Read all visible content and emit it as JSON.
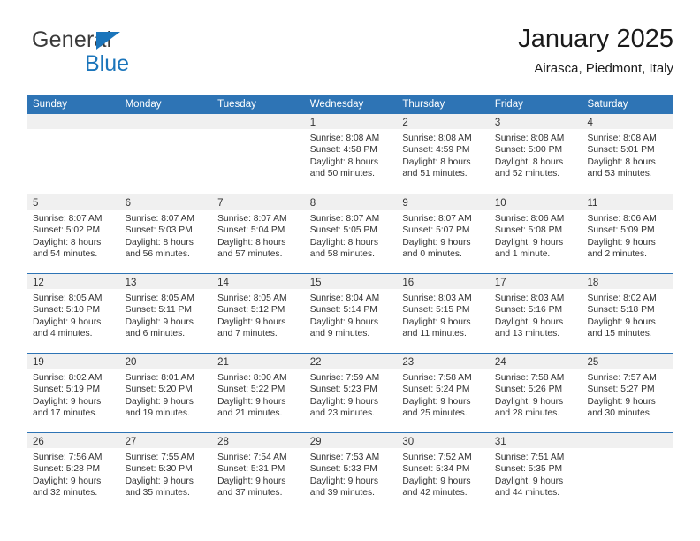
{
  "brand": {
    "name_top": "General",
    "name_bottom": "Blue",
    "triangle_color": "#1b75bb",
    "top_color": "#3b3b3b"
  },
  "header": {
    "title": "January 2025",
    "subtitle": "Airasca, Piedmont, Italy"
  },
  "theme": {
    "header_bg": "#2e74b5",
    "header_text": "#ffffff",
    "daynum_band_bg": "#f0f0f0",
    "cell_text": "#333333"
  },
  "weekdays": [
    "Sunday",
    "Monday",
    "Tuesday",
    "Wednesday",
    "Thursday",
    "Friday",
    "Saturday"
  ],
  "weeks": [
    [
      {
        "day": "",
        "lines": []
      },
      {
        "day": "",
        "lines": []
      },
      {
        "day": "",
        "lines": []
      },
      {
        "day": "1",
        "lines": [
          "Sunrise: 8:08 AM",
          "Sunset: 4:58 PM",
          "Daylight: 8 hours",
          "and 50 minutes."
        ]
      },
      {
        "day": "2",
        "lines": [
          "Sunrise: 8:08 AM",
          "Sunset: 4:59 PM",
          "Daylight: 8 hours",
          "and 51 minutes."
        ]
      },
      {
        "day": "3",
        "lines": [
          "Sunrise: 8:08 AM",
          "Sunset: 5:00 PM",
          "Daylight: 8 hours",
          "and 52 minutes."
        ]
      },
      {
        "day": "4",
        "lines": [
          "Sunrise: 8:08 AM",
          "Sunset: 5:01 PM",
          "Daylight: 8 hours",
          "and 53 minutes."
        ]
      }
    ],
    [
      {
        "day": "5",
        "lines": [
          "Sunrise: 8:07 AM",
          "Sunset: 5:02 PM",
          "Daylight: 8 hours",
          "and 54 minutes."
        ]
      },
      {
        "day": "6",
        "lines": [
          "Sunrise: 8:07 AM",
          "Sunset: 5:03 PM",
          "Daylight: 8 hours",
          "and 56 minutes."
        ]
      },
      {
        "day": "7",
        "lines": [
          "Sunrise: 8:07 AM",
          "Sunset: 5:04 PM",
          "Daylight: 8 hours",
          "and 57 minutes."
        ]
      },
      {
        "day": "8",
        "lines": [
          "Sunrise: 8:07 AM",
          "Sunset: 5:05 PM",
          "Daylight: 8 hours",
          "and 58 minutes."
        ]
      },
      {
        "day": "9",
        "lines": [
          "Sunrise: 8:07 AM",
          "Sunset: 5:07 PM",
          "Daylight: 9 hours",
          "and 0 minutes."
        ]
      },
      {
        "day": "10",
        "lines": [
          "Sunrise: 8:06 AM",
          "Sunset: 5:08 PM",
          "Daylight: 9 hours",
          "and 1 minute."
        ]
      },
      {
        "day": "11",
        "lines": [
          "Sunrise: 8:06 AM",
          "Sunset: 5:09 PM",
          "Daylight: 9 hours",
          "and 2 minutes."
        ]
      }
    ],
    [
      {
        "day": "12",
        "lines": [
          "Sunrise: 8:05 AM",
          "Sunset: 5:10 PM",
          "Daylight: 9 hours",
          "and 4 minutes."
        ]
      },
      {
        "day": "13",
        "lines": [
          "Sunrise: 8:05 AM",
          "Sunset: 5:11 PM",
          "Daylight: 9 hours",
          "and 6 minutes."
        ]
      },
      {
        "day": "14",
        "lines": [
          "Sunrise: 8:05 AM",
          "Sunset: 5:12 PM",
          "Daylight: 9 hours",
          "and 7 minutes."
        ]
      },
      {
        "day": "15",
        "lines": [
          "Sunrise: 8:04 AM",
          "Sunset: 5:14 PM",
          "Daylight: 9 hours",
          "and 9 minutes."
        ]
      },
      {
        "day": "16",
        "lines": [
          "Sunrise: 8:03 AM",
          "Sunset: 5:15 PM",
          "Daylight: 9 hours",
          "and 11 minutes."
        ]
      },
      {
        "day": "17",
        "lines": [
          "Sunrise: 8:03 AM",
          "Sunset: 5:16 PM",
          "Daylight: 9 hours",
          "and 13 minutes."
        ]
      },
      {
        "day": "18",
        "lines": [
          "Sunrise: 8:02 AM",
          "Sunset: 5:18 PM",
          "Daylight: 9 hours",
          "and 15 minutes."
        ]
      }
    ],
    [
      {
        "day": "19",
        "lines": [
          "Sunrise: 8:02 AM",
          "Sunset: 5:19 PM",
          "Daylight: 9 hours",
          "and 17 minutes."
        ]
      },
      {
        "day": "20",
        "lines": [
          "Sunrise: 8:01 AM",
          "Sunset: 5:20 PM",
          "Daylight: 9 hours",
          "and 19 minutes."
        ]
      },
      {
        "day": "21",
        "lines": [
          "Sunrise: 8:00 AM",
          "Sunset: 5:22 PM",
          "Daylight: 9 hours",
          "and 21 minutes."
        ]
      },
      {
        "day": "22",
        "lines": [
          "Sunrise: 7:59 AM",
          "Sunset: 5:23 PM",
          "Daylight: 9 hours",
          "and 23 minutes."
        ]
      },
      {
        "day": "23",
        "lines": [
          "Sunrise: 7:58 AM",
          "Sunset: 5:24 PM",
          "Daylight: 9 hours",
          "and 25 minutes."
        ]
      },
      {
        "day": "24",
        "lines": [
          "Sunrise: 7:58 AM",
          "Sunset: 5:26 PM",
          "Daylight: 9 hours",
          "and 28 minutes."
        ]
      },
      {
        "day": "25",
        "lines": [
          "Sunrise: 7:57 AM",
          "Sunset: 5:27 PM",
          "Daylight: 9 hours",
          "and 30 minutes."
        ]
      }
    ],
    [
      {
        "day": "26",
        "lines": [
          "Sunrise: 7:56 AM",
          "Sunset: 5:28 PM",
          "Daylight: 9 hours",
          "and 32 minutes."
        ]
      },
      {
        "day": "27",
        "lines": [
          "Sunrise: 7:55 AM",
          "Sunset: 5:30 PM",
          "Daylight: 9 hours",
          "and 35 minutes."
        ]
      },
      {
        "day": "28",
        "lines": [
          "Sunrise: 7:54 AM",
          "Sunset: 5:31 PM",
          "Daylight: 9 hours",
          "and 37 minutes."
        ]
      },
      {
        "day": "29",
        "lines": [
          "Sunrise: 7:53 AM",
          "Sunset: 5:33 PM",
          "Daylight: 9 hours",
          "and 39 minutes."
        ]
      },
      {
        "day": "30",
        "lines": [
          "Sunrise: 7:52 AM",
          "Sunset: 5:34 PM",
          "Daylight: 9 hours",
          "and 42 minutes."
        ]
      },
      {
        "day": "31",
        "lines": [
          "Sunrise: 7:51 AM",
          "Sunset: 5:35 PM",
          "Daylight: 9 hours",
          "and 44 minutes."
        ]
      },
      {
        "day": "",
        "lines": []
      }
    ]
  ]
}
